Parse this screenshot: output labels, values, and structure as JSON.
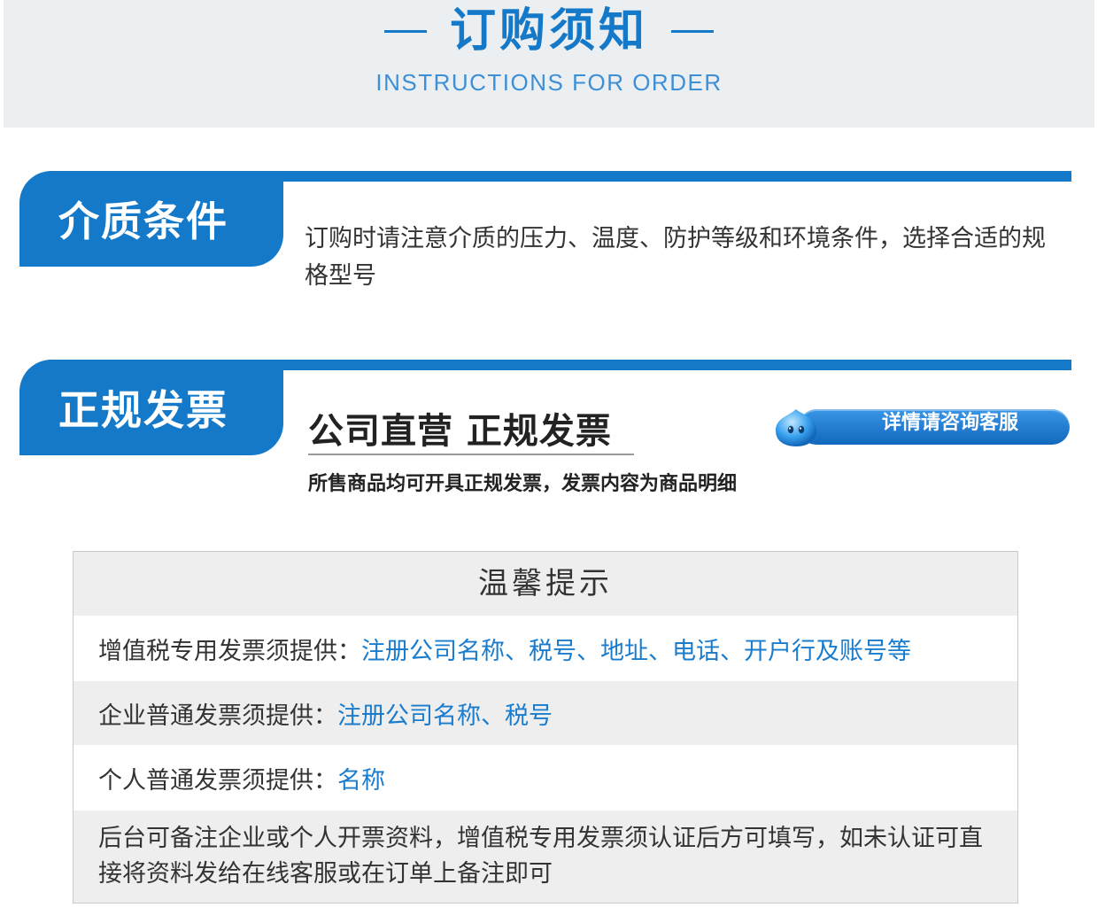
{
  "header": {
    "title": "订购须知",
    "subtitle": "INSTRUCTIONS FOR ORDER"
  },
  "medium_section": {
    "tab_label": "介质条件",
    "text": "订购时请注意介质的压力、温度、防护等级和环境条件，选择合适的规格型号"
  },
  "invoice_section": {
    "tab_label": "正规发票",
    "heading": "公司直营 正规发票",
    "note": "所售商品均可开具正规发票，发票内容为商品明细",
    "consult_button_label": "详情请咨询客服"
  },
  "tips": {
    "title": "温馨提示",
    "rows": [
      {
        "label": "增值税专用发票须提供：",
        "value": "注册公司名称、税号、地址、电话、开户行及账号等"
      },
      {
        "label": "企业普通发票须提供：",
        "value": "注册公司名称、税号"
      },
      {
        "label": "个人普通发票须提供：",
        "value": "名称"
      }
    ],
    "note": "后台可备注企业或个人开票资料，增值税专用发票须认证后方可填写，如未认证可直接将资料发给在线客服或在订单上备注即可"
  },
  "colors": {
    "brand_blue": "#1479c9",
    "highlight_blue": "#1a7ccc",
    "header_bg": "#eceff1"
  }
}
